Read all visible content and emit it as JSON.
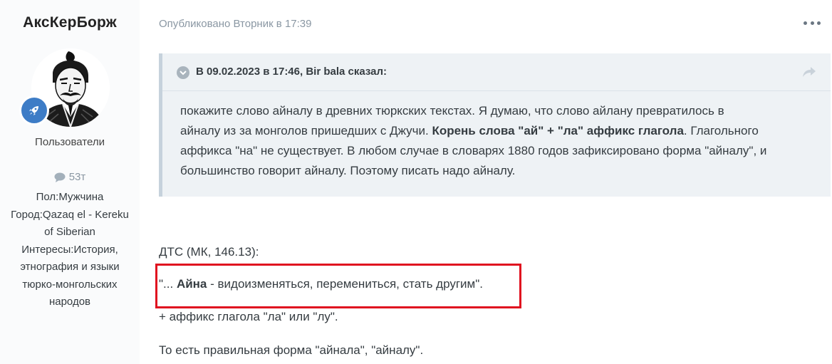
{
  "author": {
    "name": "АксКерБорж",
    "group": "Пользователи",
    "content_count": "53т",
    "fields": [
      "Пол:Мужчина",
      "Город:Qazaq el - Kereku",
      "of Siberian",
      "Интересы:История,",
      "этнография и языки",
      "тюрко-монгольских",
      "народов"
    ],
    "rank_icon": "rocket-icon",
    "rank_color": "#3d7cc6"
  },
  "post": {
    "meta": "Опубликовано Вторник в 17:39",
    "quote": {
      "citation": "В 09.02.2023 в 17:46, Bir bala сказал:",
      "lines": [
        {
          "pre": "покажите слово айналу в древних тюркских текстах. Я думаю, что слово айлану превратилось в",
          "bold": "",
          "post": ""
        },
        {
          "pre": "айналу из за монголов пришедших с Джучи. ",
          "bold": "Корень слова \"ай\" + \"ла\" аффикс глагола",
          "post": ". Глагольного"
        },
        {
          "pre": "аффикса \"на\" не существует. В любом случае в словарях 1880 годов зафиксировано форма \"айналу\",  и",
          "bold": "",
          "post": ""
        },
        {
          "pre": "большинство говорит айналу. Поэтому писать надо айналу.",
          "bold": "",
          "post": ""
        }
      ]
    },
    "body": {
      "source": "ДТС (МК, 146.13):",
      "def_pre": "\"... ",
      "def_bold": "Айна",
      "def_post": " - видоизменяться, перемениться, стать другим\".",
      "affix": "+ аффикс глагола \"ла\" или \"лу\".",
      "conclusion": "То есть правильная форма \"айнала\", \"айналу\"."
    },
    "highlight_color": "#e0101f"
  }
}
